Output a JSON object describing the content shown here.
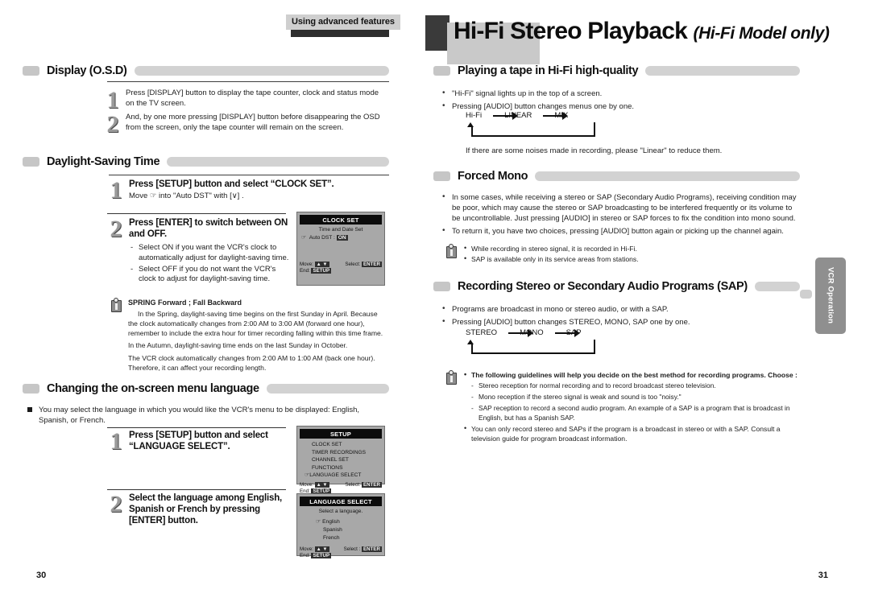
{
  "running_head": "Using advanced features",
  "chapter": {
    "title": "Hi-Fi Stereo Playback",
    "subtitle": "(Hi-Fi Model only)"
  },
  "side_tab": "VCR Operation",
  "folio": {
    "left": "30",
    "right": "31"
  },
  "left_page": {
    "sections": [
      {
        "title": "Display (O.S.D)",
        "steps": [
          {
            "num": "1",
            "text": "Press [DISPLAY] button to display the tape counter, clock and  status mode on the TV screen."
          },
          {
            "num": "2",
            "text": "And, by one more pressing [DISPLAY] button before disappearing the OSD from the screen, only the tape counter will remain on the screen."
          }
        ]
      },
      {
        "title": "Daylight-Saving Time",
        "steps": [
          {
            "num": "1",
            "heading": "Press [SETUP] button and select “CLOCK SET”.",
            "sub": "Move ☞  into \"Auto DST\" with [∨] ."
          },
          {
            "num": "2",
            "heading": "Press [ENTER] to switch between ON and OFF.",
            "bullets": [
              "Select ON if you want the VCR's clock to automatically adjust for daylight-saving time.",
              "Select OFF if you do not want the VCR's clock to adjust for daylight-saving time."
            ]
          }
        ],
        "note": {
          "title": "SPRING Forward ; Fall Backward",
          "paragraphs": [
            "In the Spring, daylight-saving time begins on the first Sunday in April. Because the clock automatically changes from 2:00 AM to 3:00 AM (forward one hour), remember to include the extra hour for timer recording falling within this time frame.",
            "In the Autumn, daylight-saving time ends on the last Sunday in October.",
            "The VCR clock automatically changes from 2:00 AM to 1:00 AM (back one hour). Therefore, it can affect your recording length."
          ]
        },
        "osd": {
          "title": "CLOCK SET",
          "subtitle": "Time and Date Set",
          "item_label": "Auto DST :",
          "item_value": "ON",
          "move_label": "Move:",
          "move_keys": "▲ ▼",
          "select_label": "Select:",
          "select_key": "ENTER",
          "end_label": "End:",
          "end_key": "SETUP"
        }
      },
      {
        "title": "Changing the on-screen menu language",
        "intro": "You may select the language in which you would like the VCR's menu to be displayed: English, Spanish, or French.",
        "steps": [
          {
            "num": "1",
            "heading": "Press [SETUP] button and select “LANGUAGE SELECT”."
          },
          {
            "num": "2",
            "heading": "Select the language among English, Spanish or French by pressing [ENTER] button."
          }
        ],
        "osd_setup": {
          "title": "SETUP",
          "items": [
            "CLOCK SET",
            "TIMER RECORDINGS",
            "CHANNEL SET",
            "FUNCTIONS",
            "LANGUAGE SELECT"
          ],
          "selected_index": 4,
          "move_label": "Move:",
          "move_keys": "▲ ▼",
          "select_label": "Select:",
          "select_key": "ENTER",
          "end_label": "End:",
          "end_key": "SETUP"
        },
        "osd_language": {
          "title": "LANGUAGE SELECT",
          "subtitle": "Select a language.",
          "items": [
            "English",
            "Spanish",
            "French"
          ],
          "selected_index": 0,
          "move_label": "Move:",
          "move_keys": "▲ ▼",
          "select_label": "Select :",
          "select_key": "ENTER",
          "end_label": "End:",
          "end_key": "SETUP"
        }
      }
    ]
  },
  "right_page": {
    "sections": [
      {
        "title": "Playing a tape in Hi-Fi high-quality",
        "bullets": [
          "\"Hi-Fi\" signal lights up in the top of a screen.",
          "Pressing [AUDIO] button changes menus one by one."
        ],
        "flow": [
          "Hi-Fi",
          "LINEAR",
          "MIX"
        ],
        "footnote": "If there are some noises made in recording, please \"Linear\" to reduce them."
      },
      {
        "title": "Forced Mono",
        "bullets": [
          "In some cases, while receiving a stereo or SAP (Secondary Audio Programs), receiving condition may be poor, which may cause the stereo or SAP broadcasting to be interfered frequently or its volume to be uncontrollable. Just pressing [AUDIO] in stereo or SAP forces to fix the condition into mono sound.",
          "To return it, you have two choices, pressing [AUDIO] button again or picking up the channel again."
        ],
        "note_items": [
          "While recording in stereo signal, it is recorded in Hi-Fi.",
          "SAP is available only in its service areas from stations."
        ]
      },
      {
        "title": "Recording Stereo or Secondary Audio Programs (SAP)",
        "bullets": [
          "Programs are broadcast in mono or stereo audio, or with a SAP.",
          "Pressing [AUDIO] button changes STEREO, MONO, SAP one by one."
        ],
        "flow": [
          "STEREO",
          "MONO",
          "SAP"
        ],
        "note": {
          "lead": "The following guidelines will help you decide on the best method for recording programs. Choose :",
          "sublist": [
            "Stereo reception for normal recording and to record broadcast stereo television.",
            "Mono reception if the stereo signal is weak and sound is too \"noisy.\"",
            "SAP reception to record a second audio program. An example of a SAP is a program that is broadcast in English, but has a Spanish SAP."
          ],
          "tail": "You can only record stereo and SAPs if the program is  a broadcast in stereo or with a SAP. Consult a television guide for program broadcast information."
        }
      }
    ]
  }
}
